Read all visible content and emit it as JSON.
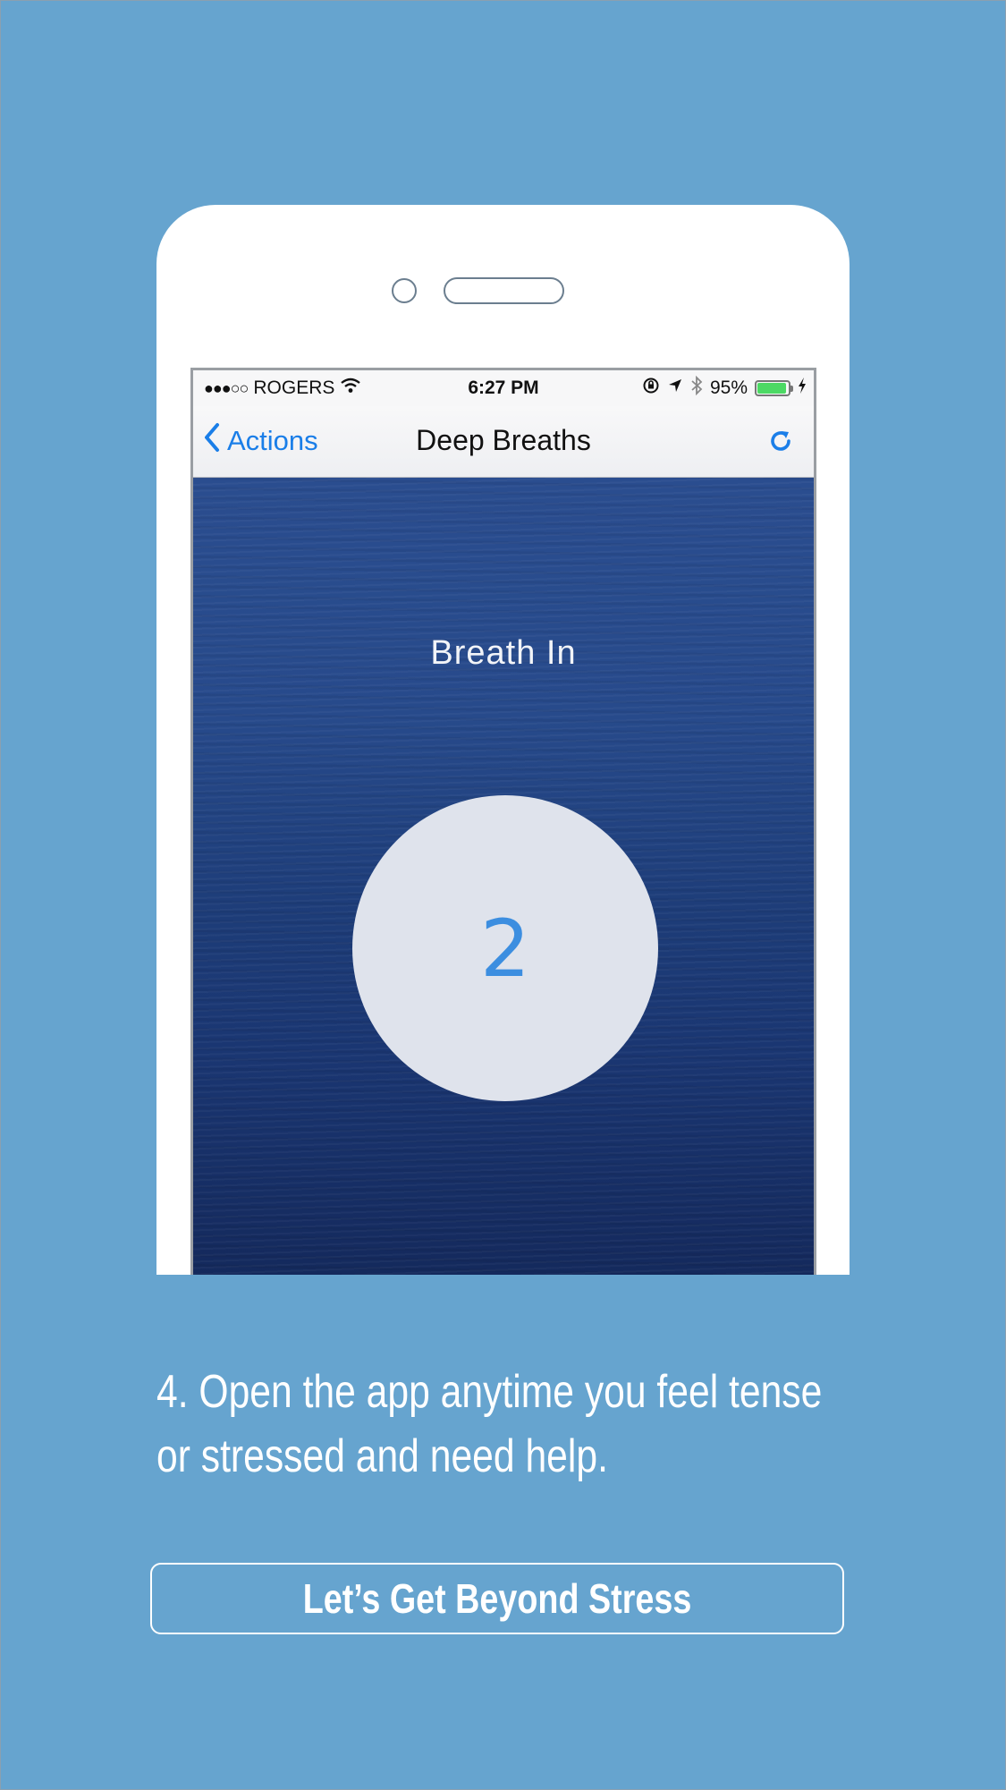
{
  "status_bar": {
    "carrier": "ROGERS",
    "signal_dots": "●●●○○",
    "time": "6:27 PM",
    "battery_percent": "95%",
    "battery_level": 0.95
  },
  "nav": {
    "back_label": "Actions",
    "title": "Deep Breaths"
  },
  "exercise": {
    "instruction": "Breath In",
    "count": "2"
  },
  "caption": {
    "line1": "4. Open the app anytime you feel tense",
    "line2": "or stressed and need help."
  },
  "cta": {
    "label": "Let’s Get Beyond Stress"
  },
  "colors": {
    "background": "#66a4cf",
    "accent": "#1a7ee8",
    "counter": "#3c8ee0",
    "battery": "#4cd964"
  }
}
